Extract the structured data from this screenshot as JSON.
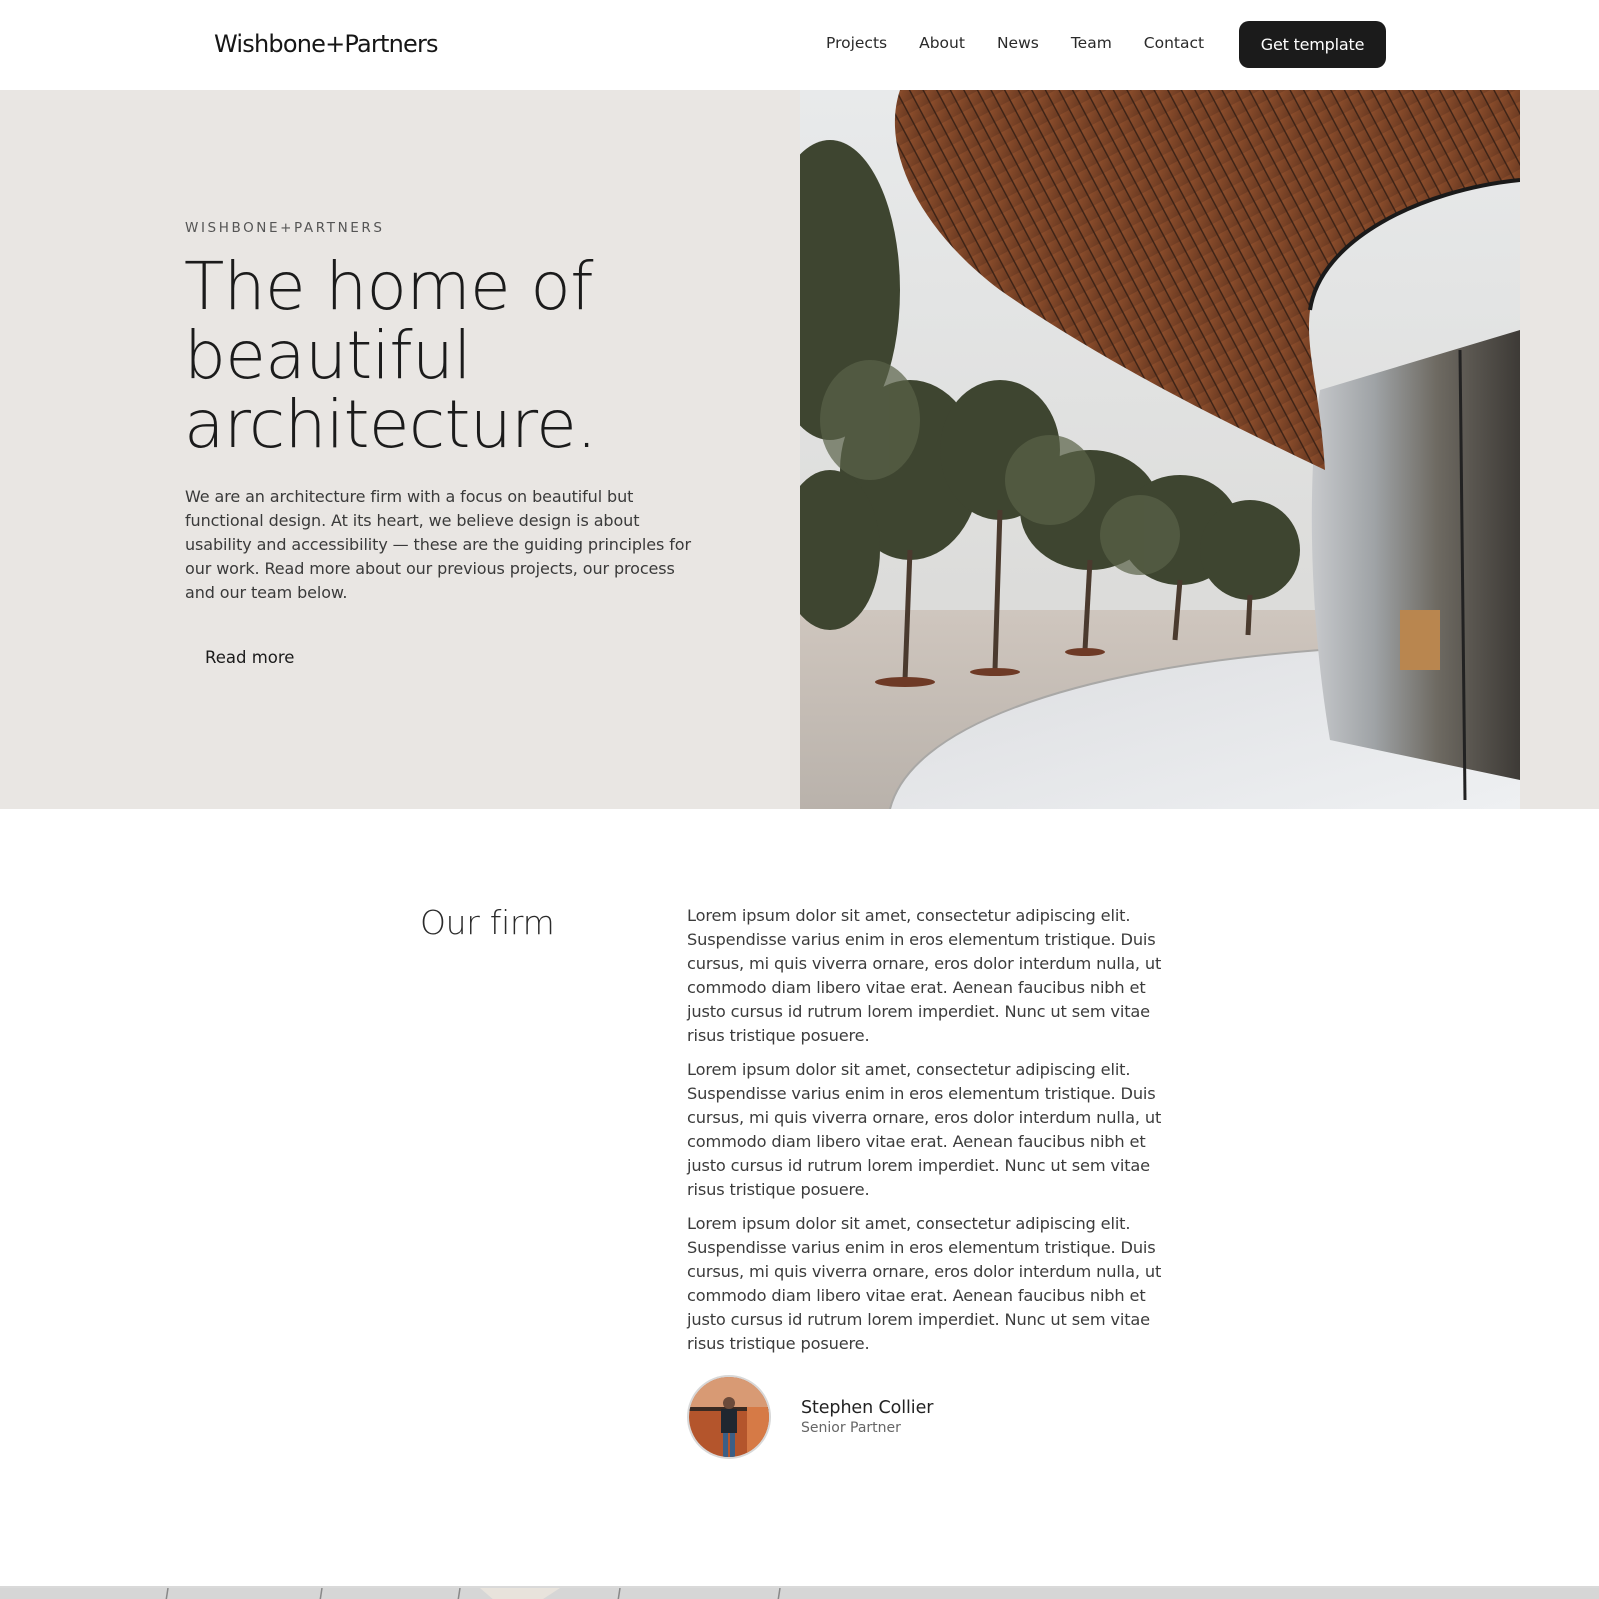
{
  "header": {
    "logo": "Wishbone+Partners",
    "nav": [
      "Projects",
      "About",
      "News",
      "Team",
      "Contact"
    ],
    "cta": "Get template"
  },
  "hero": {
    "eyebrow": "WISHBONE+PARTNERS",
    "title_lines": [
      "The home of",
      "beautiful",
      "architecture."
    ],
    "text": "We are an architecture firm with a focus on beautiful but functional design. At its heart, we believe design is about usability and accessibility — these are the guiding principles for our work. Read more about our previous projects, our process and our team below.",
    "read_more": "Read more",
    "image_icon": "architecture-photo"
  },
  "firm": {
    "heading": "Our firm",
    "paragraphs": [
      "Lorem ipsum dolor sit amet, consectetur adipiscing elit. Suspendisse varius enim in eros elementum tristique. Duis cursus, mi quis viverra ornare, eros dolor interdum nulla, ut commodo diam libero vitae erat. Aenean faucibus nibh et justo cursus id rutrum lorem imperdiet. Nunc ut sem vitae risus tristique posuere.",
      "Lorem ipsum dolor sit amet, consectetur adipiscing elit. Suspendisse varius enim in eros elementum tristique. Duis cursus, mi quis viverra ornare, eros dolor interdum nulla, ut commodo diam libero vitae erat. Aenean faucibus nibh et justo cursus id rutrum lorem imperdiet. Nunc ut sem vitae risus tristique posuere.",
      "Lorem ipsum dolor sit amet, consectetur adipiscing elit. Suspendisse varius enim in eros elementum tristique. Duis cursus, mi quis viverra ornare, eros dolor interdum nulla, ut commodo diam libero vitae erat. Aenean faucibus nibh et justo cursus id rutrum lorem imperdiet. Nunc ut sem vitae risus tristique posuere."
    ],
    "author": {
      "name": "Stephen Collier",
      "role": "Senior Partner"
    }
  },
  "colors": {
    "hero_bg": "#e9e6e3",
    "button_bg": "#1b1b1b",
    "text_dark": "#1b1b1b"
  }
}
